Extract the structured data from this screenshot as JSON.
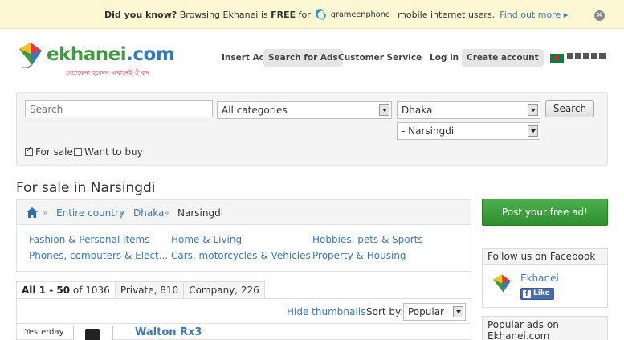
{
  "notice": {
    "did_you_know": "Did you know?",
    "text_before": " Browsing Ekhanei is ",
    "free": "FREE",
    "text_for": " for",
    "partner": "grameenphone",
    "text_after": " mobile internet users.",
    "link": "Find out more ▸",
    "close": "×"
  },
  "header": {
    "logo_name": "ekhanei",
    "logo_tld": ".com",
    "tagline": "বেচাকেনা হবেমন এখানেই ঔ কদ",
    "nav": {
      "insert_ad": "Insert Ad",
      "search_for_ads": "Search for Ads",
      "customer_service": "Customer Service",
      "login": "Log in",
      "create_account": "Create account"
    }
  },
  "search": {
    "placeholder": "Search",
    "category": "All categories",
    "region": "Dhaka",
    "area": "- Narsingdi",
    "button": "Search",
    "for_sale": "For sale",
    "want_to_buy": "Want to buy"
  },
  "page": {
    "title": "For sale in Narsingdi"
  },
  "breadcrumb": {
    "items": [
      "Entire country",
      "Dhaka",
      "Narsingdi"
    ],
    "separator": "»"
  },
  "categories": [
    "Fashion & Personal items",
    "Home & Living",
    "Hobbies, pets & Sports",
    "Phones, computers & Elect...",
    "Cars, motorcycles & Vehicles",
    "Property & Housing"
  ],
  "tabs": {
    "all_label": "All 1 - 50",
    "all_of": " of 1036",
    "private": "Private, 810",
    "company": "Company, 226"
  },
  "listing": {
    "hide_thumbnails": "Hide thumbnails",
    "sort_by": "Sort by:",
    "sort_value": "Popular",
    "first_ad": {
      "date": "Yesterday",
      "title": "Walton Rx3"
    }
  },
  "sidebar": {
    "post_button": "Post your free ad!",
    "follow_title": "Follow us on Facebook",
    "fb_page_name": "Ekhanei",
    "fb_like": "Like",
    "popular_title": "Popular ads on Ekhanei.com"
  },
  "colors": {
    "brand_green": "#3c9d3c",
    "brand_blue": "#2f7cc0",
    "link": "#3b78b5",
    "notice_bg": "#fdf7d3",
    "post_button": "#3a9e3a",
    "facebook": "#3b5998"
  }
}
